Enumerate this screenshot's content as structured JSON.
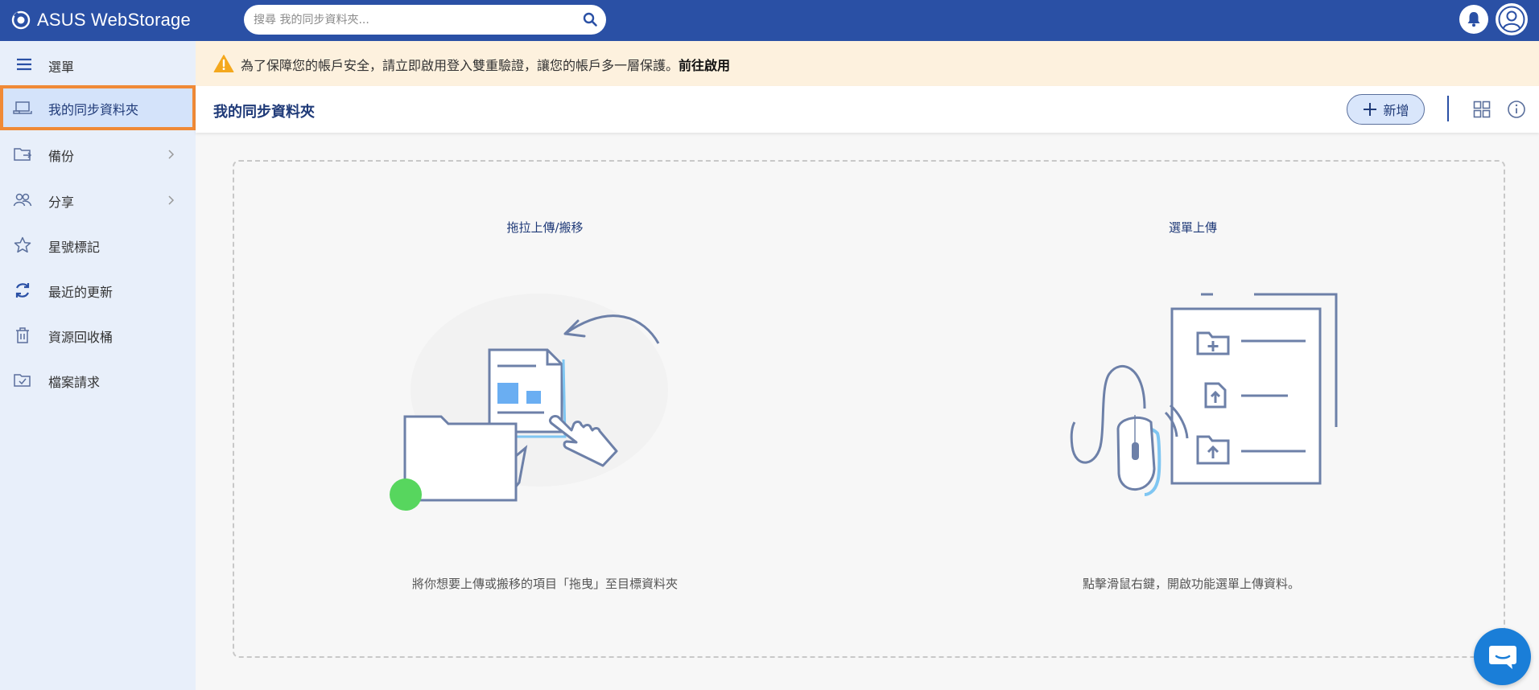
{
  "app": {
    "title": "ASUS WebStorage"
  },
  "search": {
    "placeholder": "搜尋 我的同步資料夾..."
  },
  "sidebar": {
    "menu_label": "選單",
    "items": [
      {
        "label": "我的同步資料夾",
        "icon": "sync-folder-icon",
        "active": true,
        "has_submenu": false
      },
      {
        "label": "備份",
        "icon": "backup-folder-icon",
        "active": false,
        "has_submenu": true
      },
      {
        "label": "分享",
        "icon": "share-users-icon",
        "active": false,
        "has_submenu": true
      },
      {
        "label": "星號標記",
        "icon": "star-icon",
        "active": false,
        "has_submenu": false
      },
      {
        "label": "最近的更新",
        "icon": "refresh-icon",
        "active": false,
        "has_submenu": false
      },
      {
        "label": "資源回收桶",
        "icon": "trash-icon",
        "active": false,
        "has_submenu": false
      },
      {
        "label": "檔案請求",
        "icon": "file-request-icon",
        "active": false,
        "has_submenu": false
      }
    ]
  },
  "banner": {
    "text": "為了保障您的帳戶安全，請立即啟用登入雙重驗證，讓您的帳戶多一層保護。",
    "link": "前往啟用"
  },
  "header": {
    "title": "我的同步資料夾",
    "add_label": "新增"
  },
  "dropzone": {
    "left": {
      "title": "拖拉上傳/搬移",
      "desc": "將你想要上傳或搬移的項目「拖曳」至目標資料夾"
    },
    "right": {
      "title": "選單上傳",
      "desc": "點擊滑鼠右鍵，開啟功能選單上傳資料。"
    }
  },
  "colors": {
    "topbar": "#2a50a5",
    "sidebar_bg": "#e8effa",
    "active_outline": "#f08a37",
    "banner_bg": "#fdf1de",
    "accent": "#1f3a78",
    "chat_button": "#1a7ed8"
  }
}
